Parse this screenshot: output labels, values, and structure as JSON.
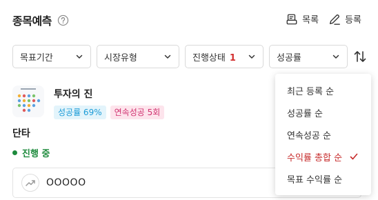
{
  "header": {
    "title": "종목예측",
    "help_icon": "question-circle-icon",
    "actions": [
      {
        "label": "목록",
        "icon": "list-icon"
      },
      {
        "label": "등록",
        "icon": "pencil-icon"
      }
    ]
  },
  "filters": {
    "goal_period": "목표기간",
    "market_type": "시장유형",
    "status": "진행상태",
    "status_count": "1",
    "success_rate": "성공률",
    "sort_icon": "sort-arrows-icon"
  },
  "item": {
    "title": "투자의 진",
    "success_badge": "성공률 69%",
    "streak_badge": "연속성공 5회"
  },
  "section_label": "단타",
  "status_text": "진행 중",
  "bottom": {
    "icon": "trend-icon",
    "text": "OOOOO"
  },
  "dropdown": {
    "items": [
      {
        "label": "최근 등록 순",
        "selected": false
      },
      {
        "label": "성공률 순",
        "selected": false
      },
      {
        "label": "연속성공 순",
        "selected": false
      },
      {
        "label": "수익률 총합 순",
        "selected": true
      },
      {
        "label": "목표 수익률 순",
        "selected": false
      }
    ],
    "selected_color": "#c62828"
  },
  "colors": {
    "status_green": "#1d8a3c",
    "accent_red": "#d32f2f",
    "badge_blue_text": "#1a9bd7",
    "badge_pink_text": "#d0316f"
  }
}
